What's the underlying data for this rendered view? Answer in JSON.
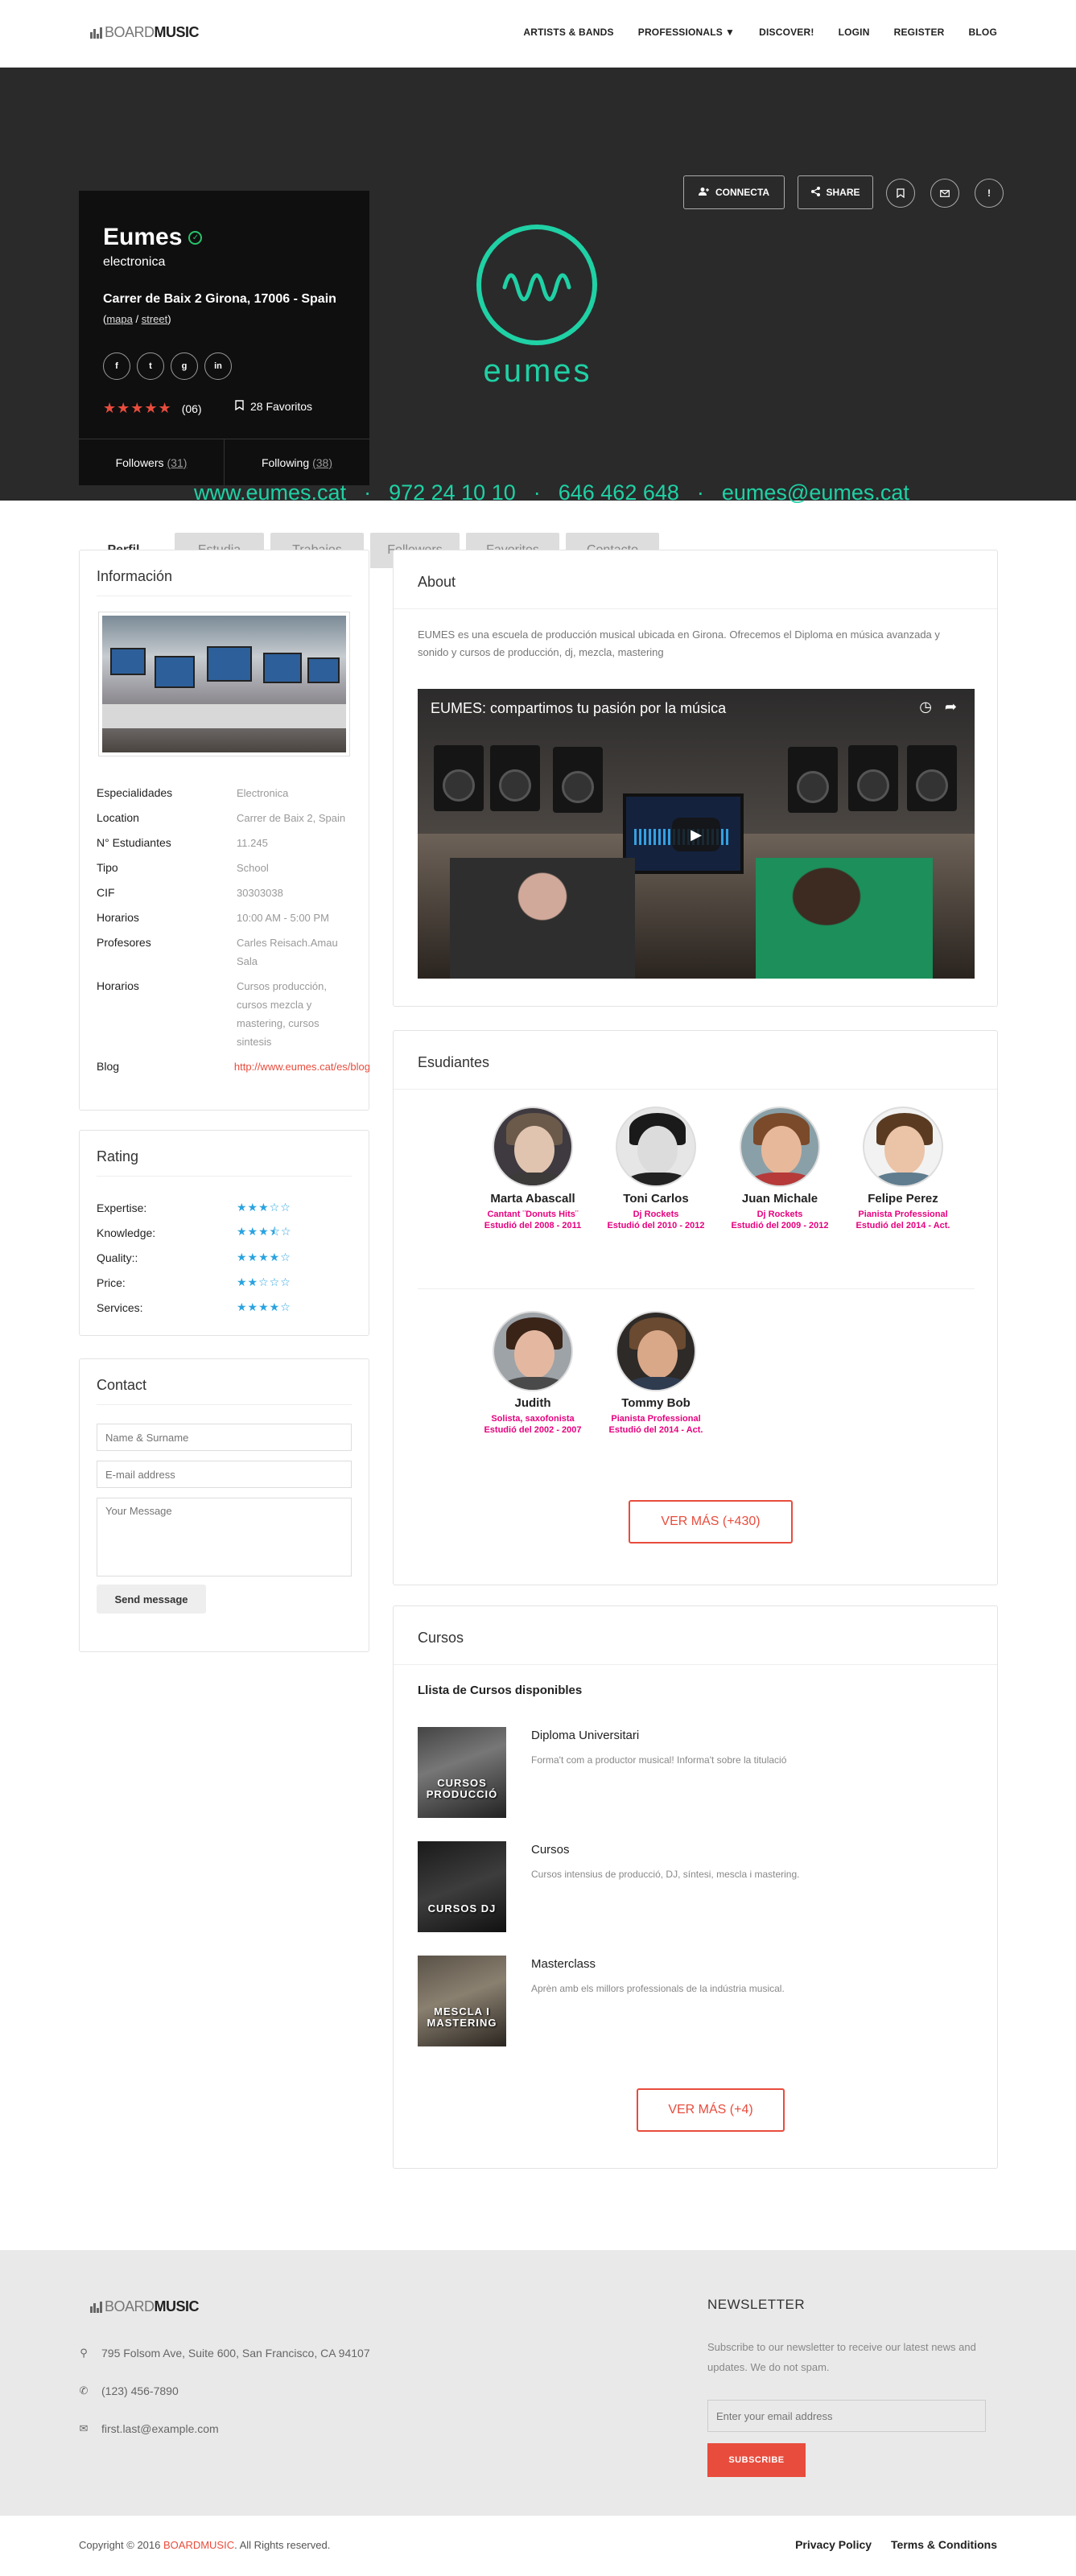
{
  "brand": {
    "part1": "BOARD",
    "part2": "MUSIC"
  },
  "nav": {
    "items": [
      "ARTISTS & BANDS",
      "PROFESSIONALS",
      "DISCOVER!",
      "LOGIN",
      "REGISTER",
      "BLOG"
    ]
  },
  "profile": {
    "name": "Eumes",
    "category": "electronica",
    "address": "Carrer de Baix 2 Girona, 17006 - Spain",
    "link_open": "(",
    "map_label": "mapa",
    "link_sep": " / ",
    "street_label": "street",
    "link_close": ")",
    "social": [
      "f",
      "t",
      "g",
      "in"
    ],
    "stars": "★★★★★",
    "rating_count": "(06)",
    "favorites": "28 Favoritos",
    "followers_label": "Followers",
    "followers_count": "(31)",
    "following_label": "Following",
    "following_count": "(38)"
  },
  "hero": {
    "logo_text": "eumes",
    "website": "www.eumes.cat",
    "phone1": "972 24 10 10",
    "phone2": "646 462 648",
    "email": "eumes@eumes.cat",
    "sep": "·",
    "connect_label": "CONNECTA",
    "share_label": "SHARE",
    "accent_color": "#1fd1a5"
  },
  "tabs": [
    "Perfil",
    "Estudia",
    "Trabajos",
    "Followers",
    "Favoritos",
    "Contacto"
  ],
  "info": {
    "title": "Información",
    "rows": [
      {
        "k": "Especialidades",
        "v": "Electronica"
      },
      {
        "k": "Location",
        "v": "Carrer de Baix 2, Spain"
      },
      {
        "k": "N° Estudiantes",
        "v": "11.245"
      },
      {
        "k": "Tipo",
        "v": "School"
      },
      {
        "k": "CIF",
        "v": "30303038"
      },
      {
        "k": "Horarios",
        "v": "10:00 AM - 5:00 PM"
      },
      {
        "k": "Profesores",
        "v": "Carles Reisach.Amau Sala"
      },
      {
        "k": "Horarios",
        "v": "Cursos producción, cursos mezcla y mastering, cursos sintesis"
      },
      {
        "k": "Blog",
        "v": "http://www.eumes.cat/es/blog"
      }
    ]
  },
  "rating": {
    "title": "Rating",
    "rows": [
      {
        "k": "Expertise:",
        "stars": "★★★☆☆"
      },
      {
        "k": "Knowledge:",
        "stars": "★★★⯪☆"
      },
      {
        "k": "Quality::",
        "stars": "★★★★☆"
      },
      {
        "k": "Price:",
        "stars": "★★☆☆☆"
      },
      {
        "k": "Services:",
        "stars": "★★★★☆"
      }
    ]
  },
  "contact": {
    "title": "Contact",
    "name_placeholder": "Name & Surname",
    "email_placeholder": "E-mail address",
    "message_placeholder": "Your Message",
    "send_label": "Send message"
  },
  "about": {
    "title": "About",
    "text": "EUMES es una escuela de producción musical ubicada en Girona. Ofrecemos el Diploma en música avanzada y sonido y cursos de producción, dj, mezcla, mastering",
    "video_title": "EUMES: compartimos tu pasión por la música"
  },
  "students": {
    "title": "Esudiantes",
    "items": [
      {
        "name": "Marta Abascall",
        "role": "Cantant ¨Donuts Hits¨",
        "years": "Estudió del 2008 - 2011"
      },
      {
        "name": "Toni Carlos",
        "role": "Dj Rockets",
        "years": "Estudió del 2010 - 2012"
      },
      {
        "name": "Juan Michale",
        "role": "Dj Rockets",
        "years": "Estudió del 2009 - 2012"
      },
      {
        "name": "Felipe Perez",
        "role": "Pianista Professional",
        "years": "Estudió del 2014 - Act."
      },
      {
        "name": "Judith",
        "role": "Solista, saxofonista",
        "years": "Estudió del 2002 - 2007"
      },
      {
        "name": "Tommy Bob",
        "role": "Pianista Professional",
        "years": "Estudió del 2014 - Act."
      }
    ],
    "more_label": "VER MÁS (+430)"
  },
  "courses": {
    "title": "Cursos",
    "subtitle": "Llista de Cursos disponibles",
    "items": [
      {
        "title": "Diploma Universitari",
        "desc": "Forma't com a productor musical! Informa't sobre la titulació",
        "thumb": "CURSOS PRODUCCIÓ"
      },
      {
        "title": "Cursos",
        "desc": "Cursos intensius de producció, DJ, síntesi, mescla i mastering.",
        "thumb": "CURSOS DJ"
      },
      {
        "title": "Masterclass",
        "desc": "Aprèn amb els millors professionals de la indústria musical.",
        "thumb": "MESCLA I MASTERING"
      }
    ],
    "more_label": "VER MÁS (+4)"
  },
  "footer": {
    "address": "795 Folsom Ave, Suite 600, San Francisco, CA 94107",
    "phone": "(123) 456-7890",
    "email": "first.last@example.com",
    "newsletter_title": "NEWSLETTER",
    "newsletter_desc": "Subscribe to our newsletter to receive our latest news and updates. We do not spam.",
    "newsletter_placeholder": "Enter your email address",
    "subscribe_label": "SUBSCRIBE",
    "copyright_pre": "Copyright © 2016 ",
    "copyright_brand": "BOARDMUSIC",
    "copyright_post": ". All Rights reserved.",
    "privacy": "Privacy Policy",
    "terms": "Terms & Conditions"
  }
}
